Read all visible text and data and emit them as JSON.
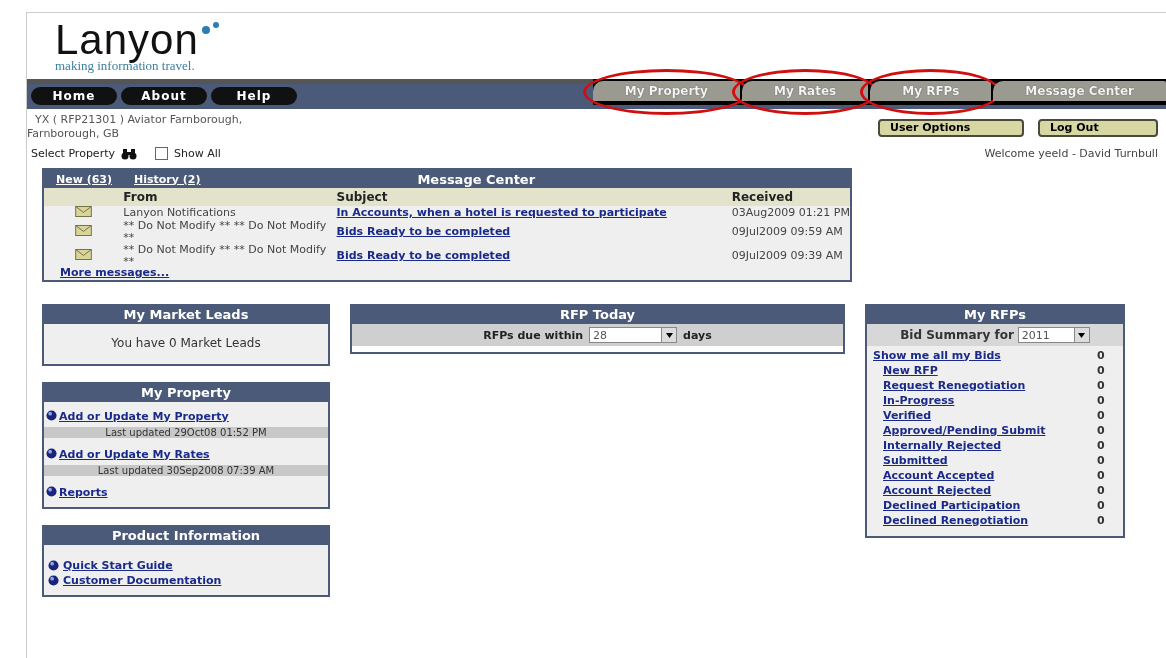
{
  "logo": {
    "name": "Lanyon",
    "tagline": "making information travel."
  },
  "nav": {
    "buttons": [
      "Home",
      "About",
      "Help"
    ],
    "tabs": [
      {
        "label": "My Property",
        "circled": true
      },
      {
        "label": "My Rates",
        "circled": true
      },
      {
        "label": "My RFPs",
        "circled": true
      },
      {
        "label": "Message Center",
        "circled": false
      }
    ]
  },
  "property": {
    "line1": "YX ( RFP21301 ) Aviator Farnborough,",
    "line2": "Farnborough, GB",
    "select_label": "Select Property",
    "show_all": {
      "label": "Show All",
      "checked": false
    }
  },
  "user_buttons": [
    "User Options",
    "Log Out"
  ],
  "welcome": "Welcome yeeld - David Turnbull",
  "message_center": {
    "title": "Message Center",
    "links": [
      "New (63)",
      "History (2)"
    ],
    "columns": [
      "From",
      "Subject",
      "Received"
    ],
    "rows": [
      {
        "from": "Lanyon Notifications",
        "subject": "In Accounts, when a hotel is requested to participate",
        "received": "03Aug2009 01:21 PM"
      },
      {
        "from": "** Do Not Modify ** ** Do Not Modify **",
        "subject": "Bids Ready to be completed",
        "received": "09Jul2009 09:59 AM"
      },
      {
        "from": "** Do Not Modify ** ** Do Not Modify **",
        "subject": "Bids Ready to be completed",
        "received": "09Jul2009 09:39 AM"
      }
    ],
    "more": "More messages..."
  },
  "market_leads": {
    "title": "My Market Leads",
    "text": "You have 0 Market Leads"
  },
  "my_property": {
    "title": "My Property",
    "items": [
      {
        "label": "Add or Update My Property",
        "updated": "Last updated 29Oct08 01:52 PM"
      },
      {
        "label": "Add or Update My Rates",
        "updated": "Last updated 30Sep2008 07:39 AM"
      },
      {
        "label": "Reports"
      }
    ]
  },
  "product_info": {
    "title": "Product Information",
    "links": [
      "Quick Start Guide",
      "Customer Documentation"
    ]
  },
  "rfp_today": {
    "title": "RFP Today",
    "label": "RFPs due within",
    "value": "28",
    "suffix": "days"
  },
  "my_rfps": {
    "title": "My RFPs",
    "label": "Bid Summary for",
    "year": "2011",
    "items": [
      {
        "label": "Show me all my Bids",
        "count": "0",
        "children": [
          {
            "label": "New RFP",
            "count": "0"
          },
          {
            "label": "Request Renegotiation",
            "count": "0"
          },
          {
            "label": "In-Progress",
            "count": "0"
          },
          {
            "label": "Verified",
            "count": "0"
          },
          {
            "label": "Approved/Pending Submit",
            "count": "0"
          },
          {
            "label": "Internally Rejected",
            "count": "0"
          },
          {
            "label": "Submitted",
            "count": "0"
          },
          {
            "label": "Account Accepted",
            "count": "0"
          },
          {
            "label": "Account Rejected",
            "count": "0"
          },
          {
            "label": "Declined Participation",
            "count": "0"
          },
          {
            "label": "Declined Renegotiation",
            "count": "0"
          }
        ]
      }
    ]
  }
}
